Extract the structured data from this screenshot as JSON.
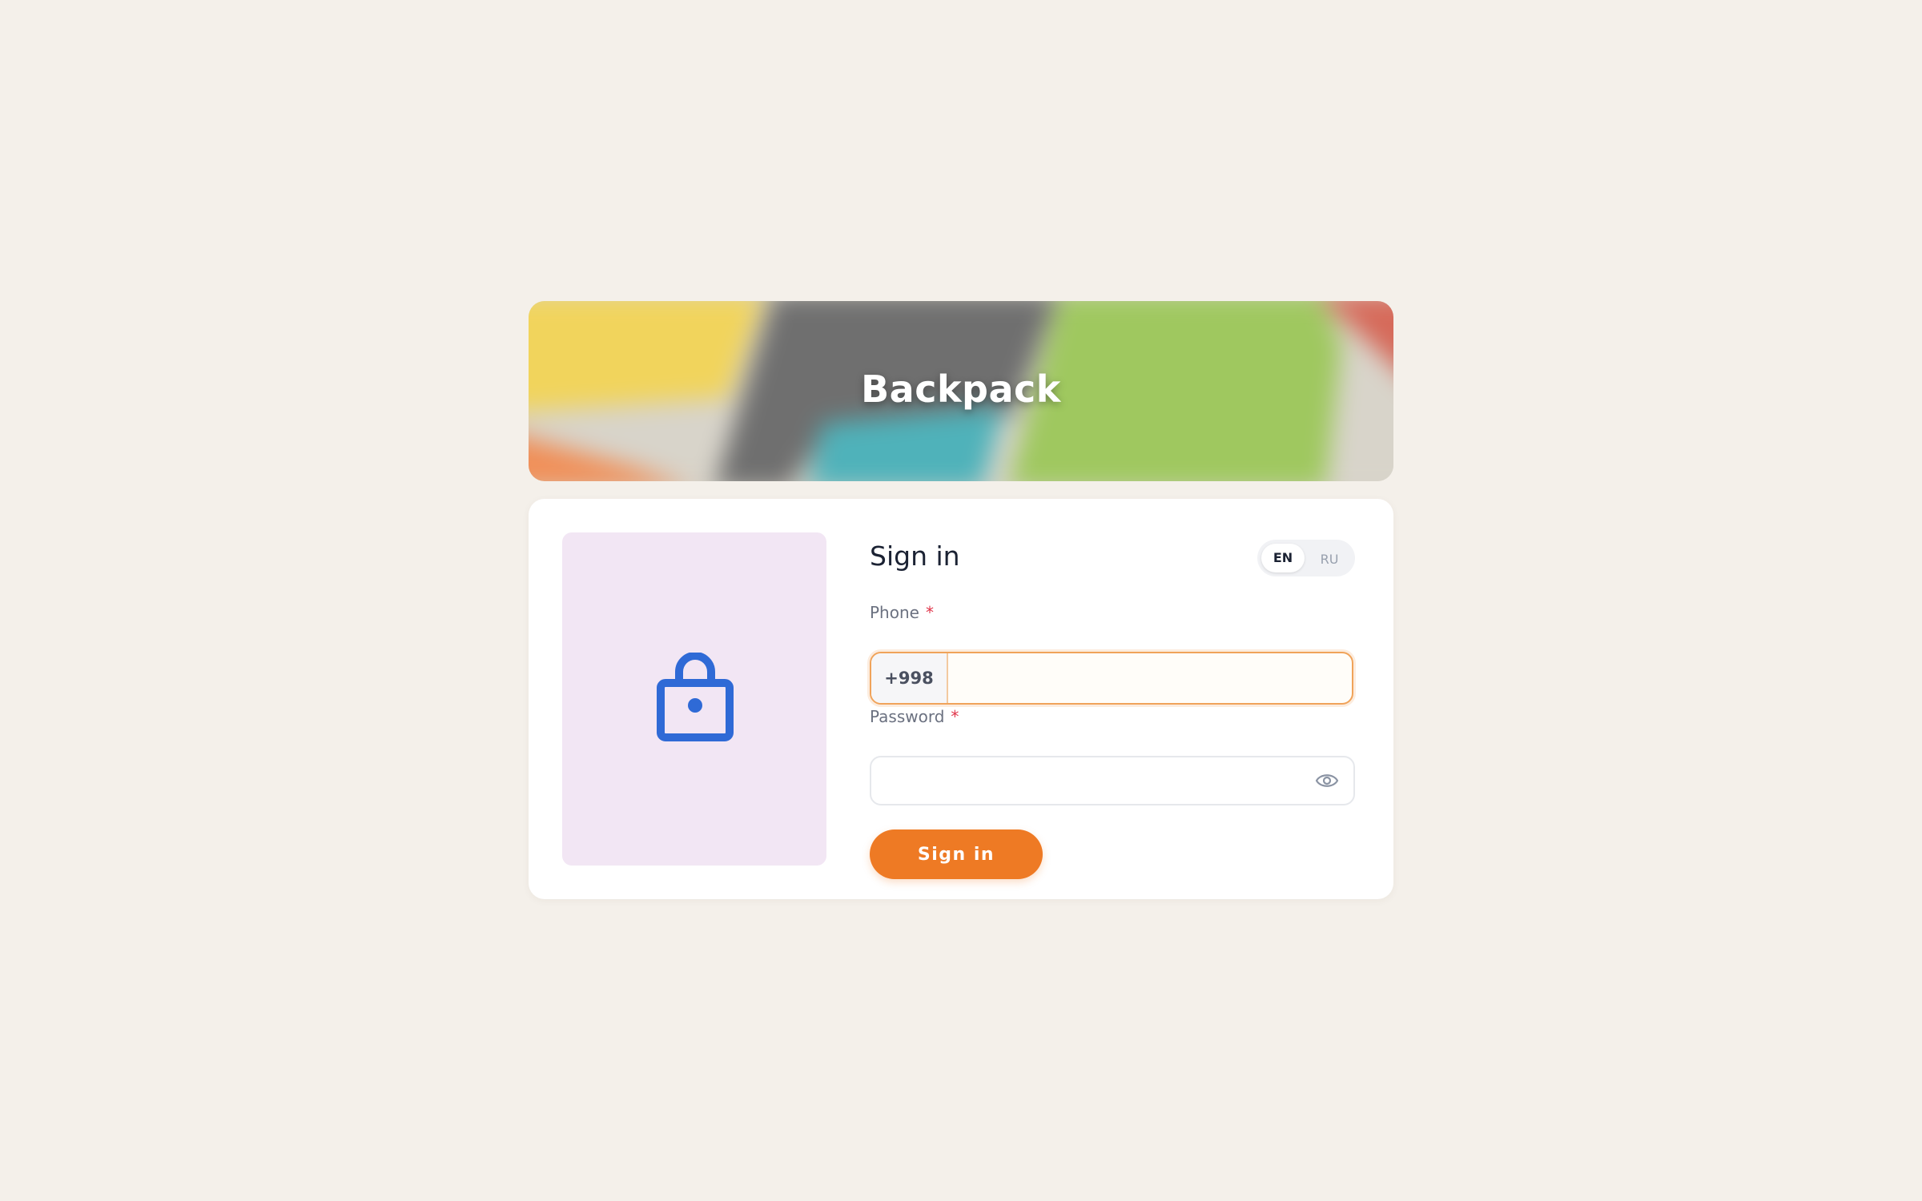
{
  "app": {
    "title": "Backpack"
  },
  "signin": {
    "title": "Sign in",
    "languages": [
      "EN",
      "RU"
    ],
    "selected_language": "EN",
    "phone": {
      "label": "Phone",
      "required_mark": "*",
      "prefix": "+998",
      "value": "",
      "placeholder": ""
    },
    "password": {
      "label": "Password",
      "required_mark": "*",
      "value": "",
      "placeholder": "",
      "toggle_icon": "eye-icon"
    },
    "submit_label": "Sign in"
  },
  "illustration": {
    "icon": "shopping-bag-icon",
    "background": "#f2e6f4",
    "icon_color": "#2f6ad6"
  },
  "colors": {
    "page_background": "#f4f0ea",
    "accent": "#ee7a24",
    "required": "#e0354a"
  }
}
